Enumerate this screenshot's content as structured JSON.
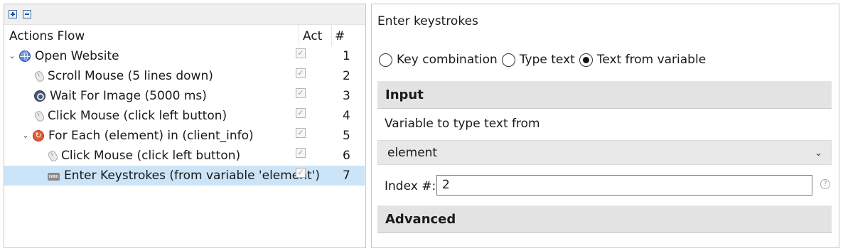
{
  "left": {
    "columns": {
      "name": "Actions Flow",
      "act": "Act",
      "num": "#"
    },
    "rows": [
      {
        "label": "Open Website",
        "num": "1",
        "icon": "globe-icon",
        "expander": "⌄"
      },
      {
        "label": "Scroll Mouse (5 lines down)",
        "num": "2",
        "icon": "mouse-icon"
      },
      {
        "label": "Wait For Image (5000 ms)",
        "num": "3",
        "icon": "wait-image-icon"
      },
      {
        "label": "Click Mouse (click left button)",
        "num": "4",
        "icon": "mouse-icon"
      },
      {
        "label": "For Each (element) in (client_info)",
        "num": "5",
        "icon": "loop-icon",
        "expander": "⌄"
      },
      {
        "label": "Click Mouse (click left button)",
        "num": "6",
        "icon": "mouse-icon"
      },
      {
        "label": "Enter Keystrokes (from variable 'element')",
        "num": "7",
        "icon": "keyboard-icon"
      }
    ]
  },
  "right": {
    "title": "Enter keystrokes",
    "modes": [
      "Key combination",
      "Type text",
      "Text from variable"
    ],
    "selected_mode": "Text from variable",
    "input_section": "Input",
    "variable_label": "Variable to type text from",
    "variable_value": "element",
    "index_label": "Index #:",
    "index_value": "2",
    "advanced_section": "Advanced"
  },
  "colors": {
    "selection": "#cce4f7",
    "section_header": "#e3e3e3"
  }
}
